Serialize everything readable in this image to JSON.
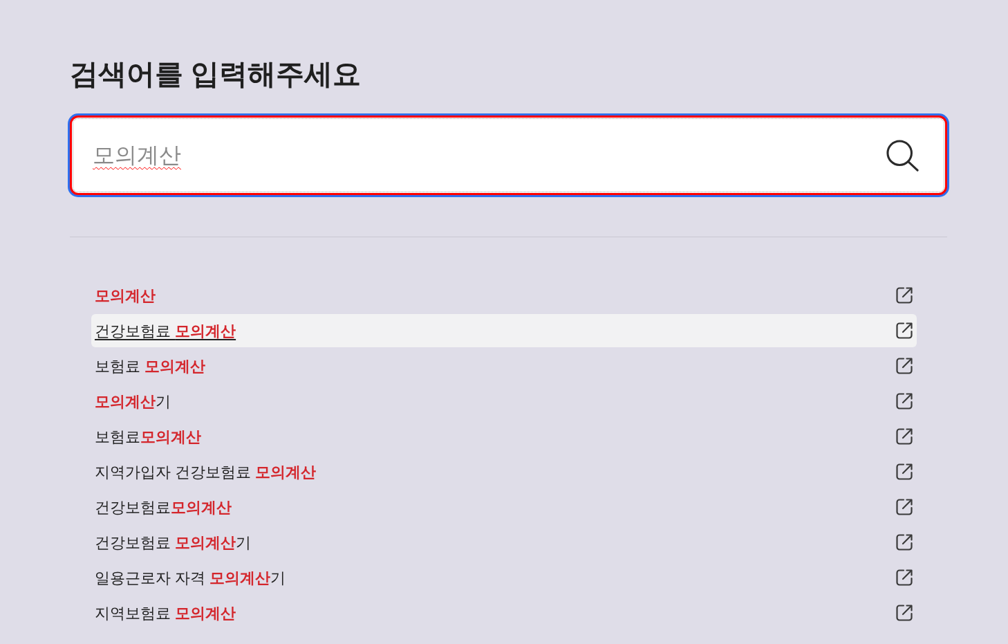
{
  "title": "검색어를 입력해주세요",
  "search": {
    "value": "모의계산",
    "focused": true
  },
  "suggestions": [
    {
      "text": "**모의계산**",
      "selected": false
    },
    {
      "text": "건강보험료 **모의계산**",
      "selected": true
    },
    {
      "text": "보험료 **모의계산**",
      "selected": false
    },
    {
      "text": "**모의계산**기",
      "selected": false
    },
    {
      "text": "보험료**모의계산**",
      "selected": false
    },
    {
      "text": "지역가입자 건강보험료 **모의계산**",
      "selected": false
    },
    {
      "text": "건강보험료**모의계산**",
      "selected": false
    },
    {
      "text": "건강보험료 **모의계산**기",
      "selected": false
    },
    {
      "text": "일용근로자 자격 **모의계산**기",
      "selected": false
    },
    {
      "text": "지역보험료 **모의계산**",
      "selected": false
    }
  ]
}
